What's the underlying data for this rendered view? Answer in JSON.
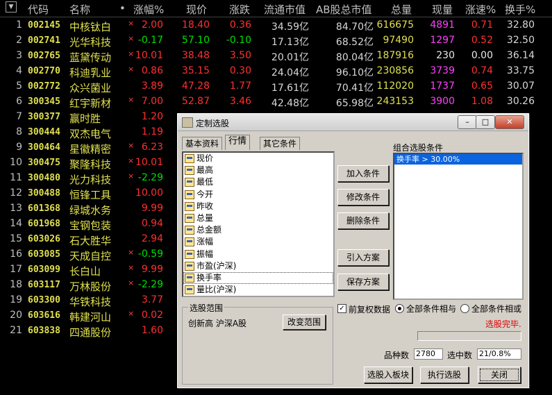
{
  "header": {
    "menu_glyph": "▼",
    "columns": [
      "代码",
      "名称",
      "•",
      "涨幅%",
      "现价",
      "涨跌",
      "流通市值",
      "AB股总市值",
      "总量",
      "现量",
      "涨速%",
      "换手%"
    ]
  },
  "rows": [
    {
      "idx": "1",
      "code": "002145",
      "name": "中核钛白",
      "mark": "×",
      "chg": "2.00",
      "price": "18.40",
      "diff": "0.36",
      "cap": "34.59亿",
      "abcap": "84.70亿",
      "vol": "616675",
      "cur": "4891",
      "spd": "0.71",
      "turn": "32.80",
      "dir": "up"
    },
    {
      "idx": "2",
      "code": "002741",
      "name": "光华科技",
      "mark": "×",
      "chg": "-0.17",
      "price": "57.10",
      "diff": "-0.10",
      "cap": "17.13亿",
      "abcap": "68.52亿",
      "vol": "97490",
      "cur": "1297",
      "spd": "0.52",
      "turn": "32.50",
      "dir": "down"
    },
    {
      "idx": "3",
      "code": "002765",
      "name": "蓝黛传动",
      "mark": "×",
      "chg": "10.01",
      "price": "38.48",
      "diff": "3.50",
      "cap": "20.01亿",
      "abcap": "80.04亿",
      "vol": "187916",
      "cur": "230",
      "spd": "0.00",
      "turn": "36.14",
      "dir": "up"
    },
    {
      "idx": "4",
      "code": "002770",
      "name": "科迪乳业",
      "mark": "×",
      "chg": "0.86",
      "price": "35.15",
      "diff": "0.30",
      "cap": "24.04亿",
      "abcap": "96.10亿",
      "vol": "230856",
      "cur": "3739",
      "spd": "0.74",
      "turn": "33.75",
      "dir": "up"
    },
    {
      "idx": "5",
      "code": "002772",
      "name": "众兴菌业",
      "mark": "",
      "chg": "3.89",
      "price": "47.28",
      "diff": "1.77",
      "cap": "17.61亿",
      "abcap": "70.41亿",
      "vol": "112020",
      "cur": "1737",
      "spd": "0.65",
      "turn": "30.07",
      "dir": "up"
    },
    {
      "idx": "6",
      "code": "300345",
      "name": "红宇新材",
      "mark": "×",
      "chg": "7.00",
      "price": "52.87",
      "diff": "3.46",
      "cap": "42.48亿",
      "abcap": "65.98亿",
      "vol": "243153",
      "cur": "3900",
      "spd": "1.08",
      "turn": "30.26",
      "dir": "up"
    },
    {
      "idx": "7",
      "code": "300377",
      "name": "赢时胜",
      "mark": "",
      "chg": "1.20",
      "price": "",
      "diff": "",
      "cap": "",
      "abcap": "",
      "vol": "",
      "cur": "",
      "spd": "",
      "turn": "",
      "dir": "up"
    },
    {
      "idx": "8",
      "code": "300444",
      "name": "双杰电气",
      "mark": "",
      "chg": "1.19",
      "price": "",
      "diff": "",
      "cap": "",
      "abcap": "",
      "vol": "",
      "cur": "",
      "spd": "",
      "turn": "",
      "dir": "up"
    },
    {
      "idx": "9",
      "code": "300464",
      "name": "星徽精密",
      "mark": "×",
      "chg": "6.23",
      "price": "",
      "diff": "",
      "cap": "",
      "abcap": "",
      "vol": "",
      "cur": "",
      "spd": "",
      "turn": "",
      "dir": "up"
    },
    {
      "idx": "10",
      "code": "300475",
      "name": "聚隆科技",
      "mark": "×",
      "chg": "10.01",
      "price": "",
      "diff": "",
      "cap": "",
      "abcap": "",
      "vol": "",
      "cur": "",
      "spd": "",
      "turn": "",
      "dir": "up"
    },
    {
      "idx": "11",
      "code": "300480",
      "name": "光力科技",
      "mark": "×",
      "chg": "-2.29",
      "price": "",
      "diff": "",
      "cap": "",
      "abcap": "",
      "vol": "",
      "cur": "",
      "spd": "",
      "turn": "",
      "dir": "down"
    },
    {
      "idx": "12",
      "code": "300488",
      "name": "恒锋工具",
      "mark": "",
      "chg": "10.00",
      "price": "",
      "diff": "",
      "cap": "",
      "abcap": "",
      "vol": "",
      "cur": "",
      "spd": "",
      "turn": "",
      "dir": "up"
    },
    {
      "idx": "13",
      "code": "601368",
      "name": "绿城水务",
      "mark": "",
      "chg": "9.99",
      "price": "",
      "diff": "",
      "cap": "",
      "abcap": "",
      "vol": "",
      "cur": "",
      "spd": "",
      "turn": "",
      "dir": "up"
    },
    {
      "idx": "14",
      "code": "601968",
      "name": "宝钢包装",
      "mark": "",
      "chg": "0.94",
      "price": "",
      "diff": "",
      "cap": "",
      "abcap": "",
      "vol": "",
      "cur": "",
      "spd": "",
      "turn": "",
      "dir": "up"
    },
    {
      "idx": "15",
      "code": "603026",
      "name": "石大胜华",
      "mark": "",
      "chg": "2.94",
      "price": "",
      "diff": "",
      "cap": "",
      "abcap": "",
      "vol": "",
      "cur": "",
      "spd": "",
      "turn": "",
      "dir": "up"
    },
    {
      "idx": "16",
      "code": "603085",
      "name": "天成自控",
      "mark": "×",
      "chg": "-0.59",
      "price": "",
      "diff": "",
      "cap": "",
      "abcap": "",
      "vol": "",
      "cur": "",
      "spd": "",
      "turn": "",
      "dir": "down"
    },
    {
      "idx": "17",
      "code": "603099",
      "name": "长白山",
      "mark": "×",
      "chg": "9.99",
      "price": "",
      "diff": "",
      "cap": "",
      "abcap": "",
      "vol": "",
      "cur": "",
      "spd": "",
      "turn": "",
      "dir": "up"
    },
    {
      "idx": "18",
      "code": "603117",
      "name": "万林股份",
      "mark": "×",
      "chg": "-2.29",
      "price": "",
      "diff": "",
      "cap": "",
      "abcap": "",
      "vol": "",
      "cur": "",
      "spd": "",
      "turn": "",
      "dir": "down"
    },
    {
      "idx": "19",
      "code": "603300",
      "name": "华铁科技",
      "mark": "",
      "chg": "3.77",
      "price": "",
      "diff": "",
      "cap": "",
      "abcap": "",
      "vol": "",
      "cur": "",
      "spd": "",
      "turn": "",
      "dir": "up"
    },
    {
      "idx": "20",
      "code": "603616",
      "name": "韩建河山",
      "mark": "×",
      "chg": "0.02",
      "price": "",
      "diff": "",
      "cap": "",
      "abcap": "",
      "vol": "",
      "cur": "",
      "spd": "",
      "turn": "",
      "dir": "up"
    },
    {
      "idx": "21",
      "code": "603838",
      "name": "四通股份",
      "mark": "",
      "chg": "1.60",
      "price": "",
      "diff": "",
      "cap": "",
      "abcap": "",
      "vol": "",
      "cur": "",
      "spd": "",
      "turn": "",
      "dir": "up"
    }
  ],
  "dialog": {
    "title": "定制选股",
    "win_buttons": {
      "minimize": "–",
      "maximize": "□",
      "close": "✕"
    },
    "tabs": [
      "基本资料",
      "行情",
      "其它条件"
    ],
    "active_tab": 1,
    "fields": [
      "现价",
      "最高",
      "最低",
      "今开",
      "昨收",
      "总量",
      "总金额",
      "涨幅",
      "振幅",
      "市盈(沪深)",
      "换手率",
      "量比(沪深)"
    ],
    "selected_field": "换手率",
    "buttons": {
      "add": "加入条件",
      "modify": "修改条件",
      "delete": "删除条件",
      "import": "引入方案",
      "save": "保存方案"
    },
    "conditions_label": "组合选股条件",
    "conditions": [
      "换手率 > 30.00%"
    ],
    "range_label": "选股范围",
    "range_value": "创新高 沪深A股",
    "change_range": "改变范围",
    "adjust_label": "前复权数据",
    "adjust_checked": true,
    "radio_and": "全部条件相与",
    "radio_or": "全部条件相或",
    "status": "选股完毕.",
    "count_label": "品种数",
    "count_value": "2780",
    "selected_label": "选中数",
    "selected_value": "21/0.8%",
    "btn_to_board": "选股入板块",
    "btn_execute": "执行选股",
    "btn_close": "关闭",
    "colors": {
      "up": "#ff3030",
      "down": "#00e000",
      "status": "#e00000",
      "selection": "#0a64e0"
    }
  }
}
